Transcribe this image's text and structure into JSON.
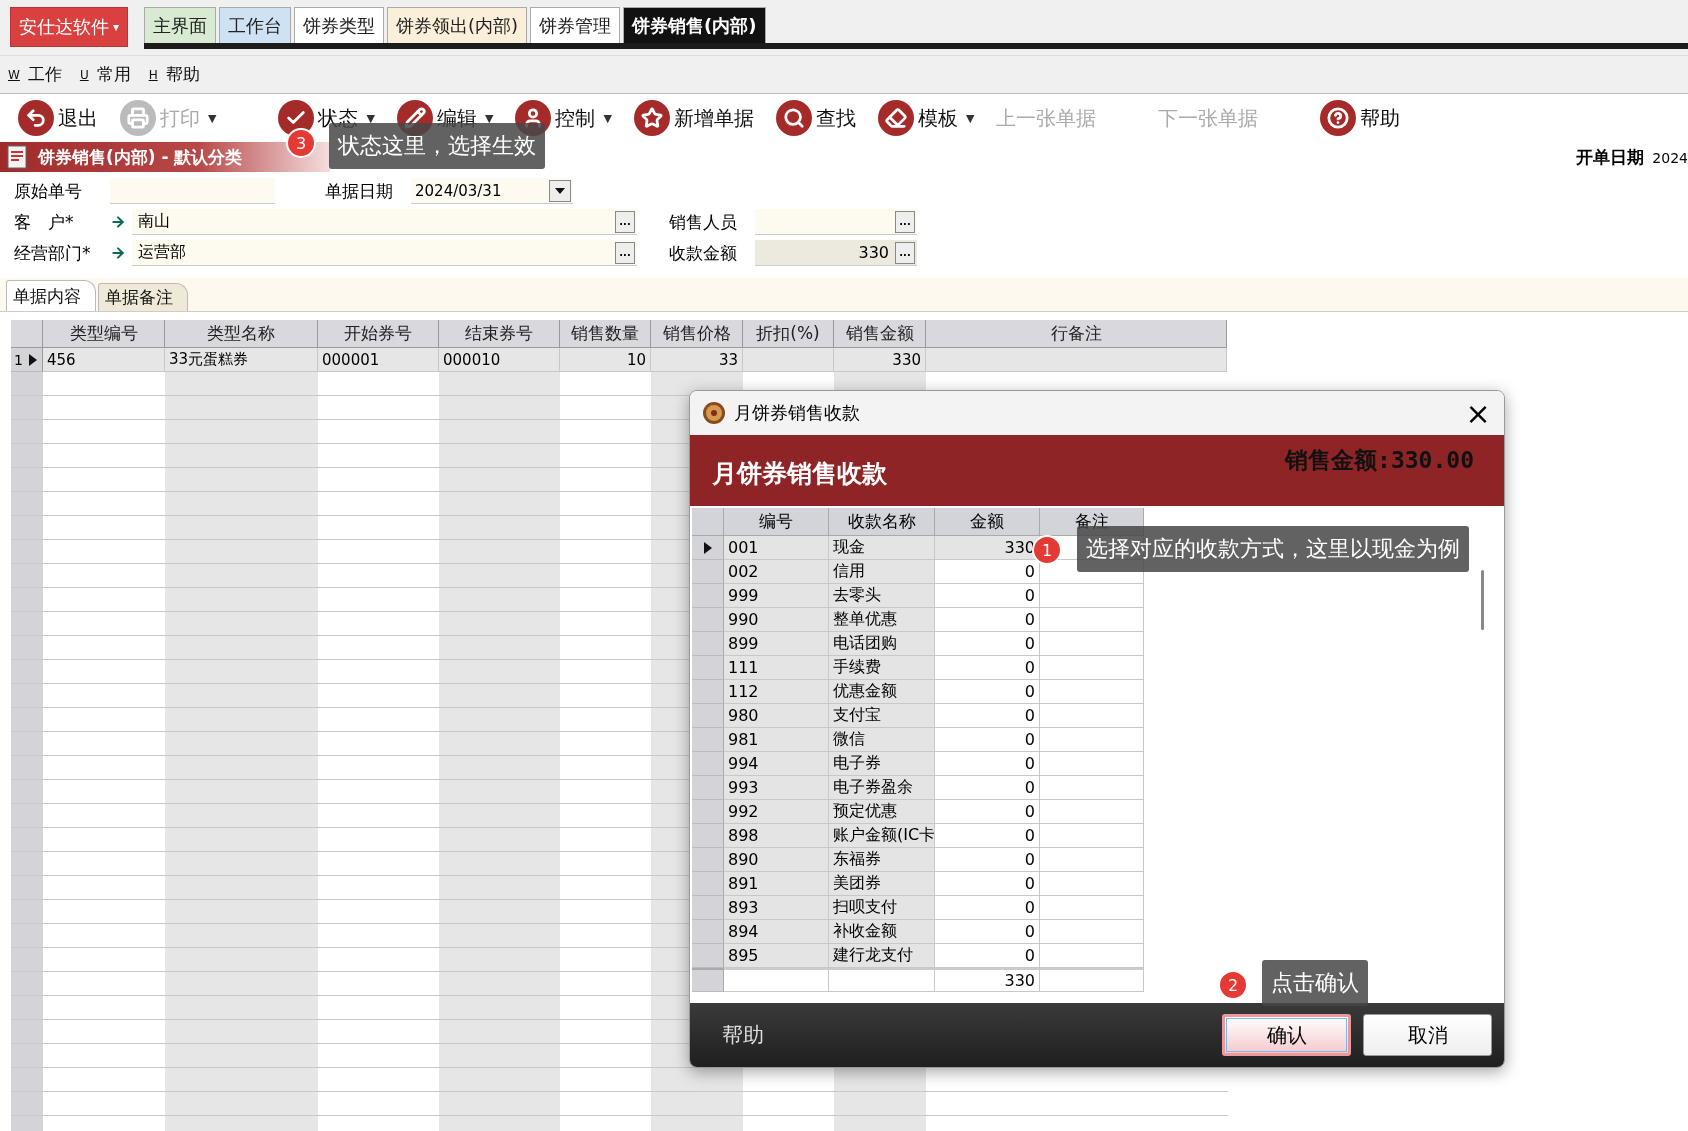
{
  "app_menu": {
    "label": "安仕达软件",
    "caret": "▾"
  },
  "top_tabs": [
    {
      "label": "主界面",
      "selected": false,
      "color": "#d9ead3"
    },
    {
      "label": "工作台",
      "selected": false,
      "color": "#cfe2f3"
    },
    {
      "label": "饼券类型",
      "selected": false,
      "color": "#ffffff"
    },
    {
      "label": "饼券领出(内部)",
      "selected": false,
      "color": "#fcefd9"
    },
    {
      "label": "饼券管理",
      "selected": false,
      "color": "#ffffff"
    },
    {
      "label": "饼券销售(内部)",
      "selected": true,
      "color": "#111111"
    }
  ],
  "menu": [
    {
      "key": "W",
      "label": "工作"
    },
    {
      "key": "U",
      "label": "常用"
    },
    {
      "key": "H",
      "label": "帮助"
    }
  ],
  "toolbar": [
    {
      "label": "退出",
      "kind": "exit",
      "disabled": false
    },
    {
      "label": "打印",
      "kind": "print",
      "disabled": true,
      "caret": "▼"
    },
    {
      "label": "状态",
      "kind": "status",
      "disabled": false,
      "caret": "▼"
    },
    {
      "label": "编辑",
      "kind": "edit",
      "disabled": false,
      "caret": "▼"
    },
    {
      "label": "控制",
      "kind": "control",
      "disabled": false,
      "caret": "▼"
    },
    {
      "label": "新增单据",
      "kind": "new",
      "disabled": false
    },
    {
      "label": "查找",
      "kind": "find",
      "disabled": false
    },
    {
      "label": "模板",
      "kind": "template",
      "disabled": false,
      "caret": "▼"
    },
    {
      "label": "上一张单据",
      "kind": "text",
      "disabled": true
    },
    {
      "label": "下一张单据",
      "kind": "text",
      "disabled": true
    },
    {
      "label": "帮助",
      "kind": "help",
      "disabled": false
    }
  ],
  "document": {
    "title": "饼券销售(内部) - 默认分类",
    "open_date_label": "开单日期",
    "open_date_value": "2024"
  },
  "form": {
    "original_no": {
      "label": "原始单号"
    },
    "doc_date": {
      "label": "单据日期",
      "value": "2024/03/31"
    },
    "customer": {
      "label": "客　户*",
      "value": "南山",
      "button": "..."
    },
    "salesperson": {
      "label": "销售人员",
      "button": "..."
    },
    "department": {
      "label": "经营部门*",
      "value": "运营部",
      "button": "..."
    },
    "receipt_amount": {
      "label": "收款金额",
      "value": "330",
      "button": "..."
    }
  },
  "tabs": [
    {
      "label": "单据内容",
      "selected": true
    },
    {
      "label": "单据备注",
      "selected": false
    }
  ],
  "table": {
    "columns": [
      "类型编号",
      "类型名称",
      "开始券号",
      "结束券号",
      "销售数量",
      "销售价格",
      "折扣(%)",
      "销售金额",
      "行备注"
    ],
    "rows": [
      {
        "index": "1",
        "current": true,
        "cells": [
          "456",
          "33元蛋糕券",
          "000001",
          "000010",
          "10",
          "33",
          "",
          "330",
          ""
        ]
      }
    ]
  },
  "dialog": {
    "title": "月饼券销售收款",
    "close": "×",
    "header": "月饼券销售收款",
    "total_label": "销售金额:330.00",
    "columns": [
      "编号",
      "收款名称",
      "金额",
      "备注"
    ],
    "rows": [
      {
        "code": "001",
        "name": "现金",
        "amount": "330",
        "current": true
      },
      {
        "code": "002",
        "name": "信用",
        "amount": "0",
        "current": false
      },
      {
        "code": "999",
        "name": "去零头",
        "amount": "0",
        "current": false
      },
      {
        "code": "990",
        "name": "整单优惠",
        "amount": "0",
        "current": false
      },
      {
        "code": "899",
        "name": "电话团购",
        "amount": "0",
        "current": false
      },
      {
        "code": "111",
        "name": "手续费",
        "amount": "0",
        "current": false
      },
      {
        "code": "112",
        "name": "优惠金额",
        "amount": "0",
        "current": false
      },
      {
        "code": "980",
        "name": "支付宝",
        "amount": "0",
        "current": false
      },
      {
        "code": "981",
        "name": "微信",
        "amount": "0",
        "current": false
      },
      {
        "code": "994",
        "name": "电子券",
        "amount": "0",
        "current": false
      },
      {
        "code": "993",
        "name": "电子券盈余",
        "amount": "0",
        "current": false
      },
      {
        "code": "992",
        "name": "预定优惠",
        "amount": "0",
        "current": false
      },
      {
        "code": "898",
        "name": "账户金额(IC卡",
        "amount": "0",
        "current": false
      },
      {
        "code": "890",
        "name": "东福券",
        "amount": "0",
        "current": false
      },
      {
        "code": "891",
        "name": "美团券",
        "amount": "0",
        "current": false
      },
      {
        "code": "893",
        "name": "扫呗支付",
        "amount": "0",
        "current": false
      },
      {
        "code": "894",
        "name": "补收金额",
        "amount": "0",
        "current": false
      },
      {
        "code": "895",
        "name": "建行龙支付",
        "amount": "0",
        "current": false
      }
    ],
    "footer_total": "330",
    "help": "帮助",
    "buttons": [
      {
        "label": "确认",
        "primary": true
      },
      {
        "label": "取消",
        "primary": false
      }
    ]
  },
  "callouts": [
    {
      "number": "3",
      "text": "状态这里，选择生效"
    },
    {
      "number": "1",
      "text": "选择对应的收款方式，这里以现金为例"
    },
    {
      "number": "2",
      "text": "点击确认"
    }
  ]
}
